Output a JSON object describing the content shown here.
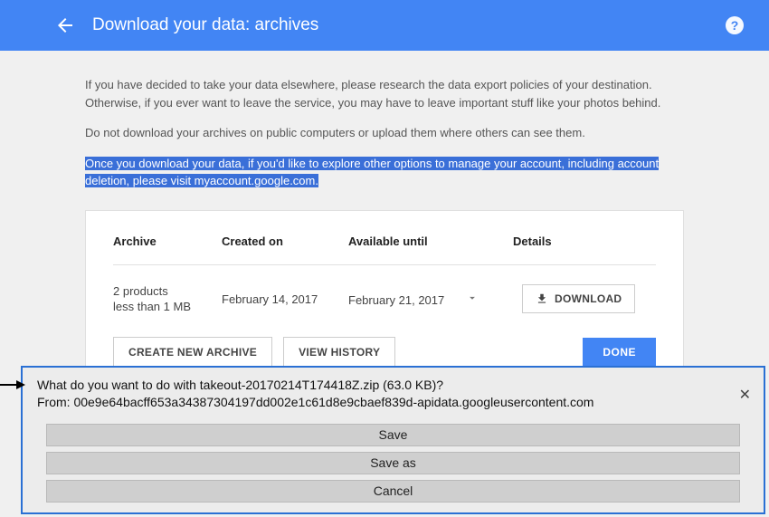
{
  "header": {
    "title": "Download your data: archives"
  },
  "intro": {
    "p1": "If you have decided to take your data elsewhere, please research the data export policies of your destination. Otherwise, if you ever want to leave the service, you may have to leave important stuff like your photos behind.",
    "p2": "Do not download your archives on public computers or upload them where others can see them.",
    "p3": "Once you download your data, if you'd like to explore other options to manage your account, including account deletion, please visit myaccount.google.com."
  },
  "table": {
    "headers": {
      "archive": "Archive",
      "created": "Created on",
      "available": "Available until",
      "details": "Details"
    },
    "row": {
      "archive_line1": "2 products",
      "archive_line2": "less than 1 MB",
      "created": "February 14, 2017",
      "available": "February 21, 2017",
      "download_label": "DOWNLOAD"
    }
  },
  "actions": {
    "create": "CREATE NEW ARCHIVE",
    "history": "VIEW HISTORY",
    "done": "DONE"
  },
  "dialog": {
    "line1": "What do you want to do with takeout-20170214T174418Z.zip (63.0 KB)?",
    "line2": "From: 00e9e64bacff653a34387304197dd002e1c61d8e9cbaef839d-apidata.googleusercontent.com",
    "save": "Save",
    "saveas": "Save as",
    "cancel": "Cancel"
  }
}
